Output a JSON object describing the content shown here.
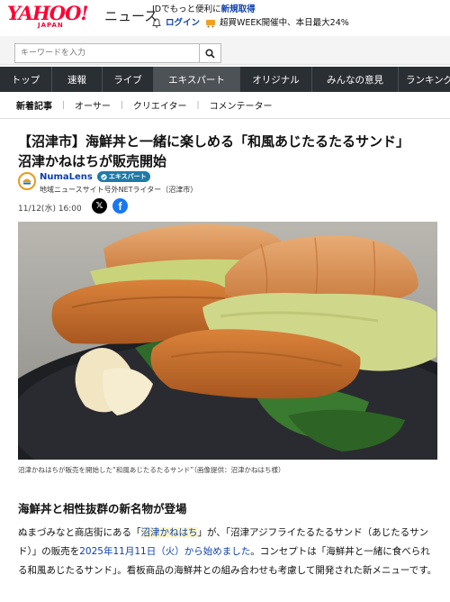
{
  "header": {
    "logo": "YAHOO!",
    "logo_sub": "JAPAN",
    "service": "ニュース",
    "promo_line1_prefix": "IDでもっと便利に",
    "promo_line1_link": "新規取得",
    "login": "ログイン",
    "promo_line2": "超買WEEK開催中、本日最大24%"
  },
  "search": {
    "placeholder": "キーワードを入力"
  },
  "nav": {
    "items": [
      "トップ",
      "速報",
      "ライブ",
      "エキスパート",
      "オリジナル",
      "みんなの意見",
      "ランキング"
    ],
    "active": "エキスパート"
  },
  "subnav": {
    "items": [
      "新着記事",
      "オーサー",
      "クリエイター",
      "コメンテーター"
    ]
  },
  "article": {
    "title_line1": "【沼津市】海鮮丼と一緒に楽しめる「和風あじたるたるサンド」",
    "title_line2": "沼津かねはちが販売開始",
    "author": "NumaLens",
    "badge": "エキスパート",
    "author_desc": "地域ニュースサイト号外NETライター（沼津市）",
    "date": "11/12(水) 16:00",
    "caption": "沼津かねはちが販売を開始した“和風あじたるたるサンド”（画像提供：沼津かねはち様）",
    "heading": "海鮮丼と相性抜群の新名物が登場",
    "p1": "ぬまづみなと商店街にある「",
    "p1_link": "沼津かねはち",
    "p2": "」が、「沼津アジフライたるたるサンド（あじたるサンド）」の販売を",
    "p2_date": "2025年11月11日（火）から始めました",
    "p3": "。コンセプトは「海鮮丼と一緒に食べられる和風あじたるサンド」。看板商品の海鮮丼との組み合わせも考慮して開発された新メニューです。"
  },
  "colors": {
    "nav_bg": "#2a2f33",
    "nav_active": "#4c5256",
    "link": "#0b3fad",
    "brand": "#ff0033"
  }
}
